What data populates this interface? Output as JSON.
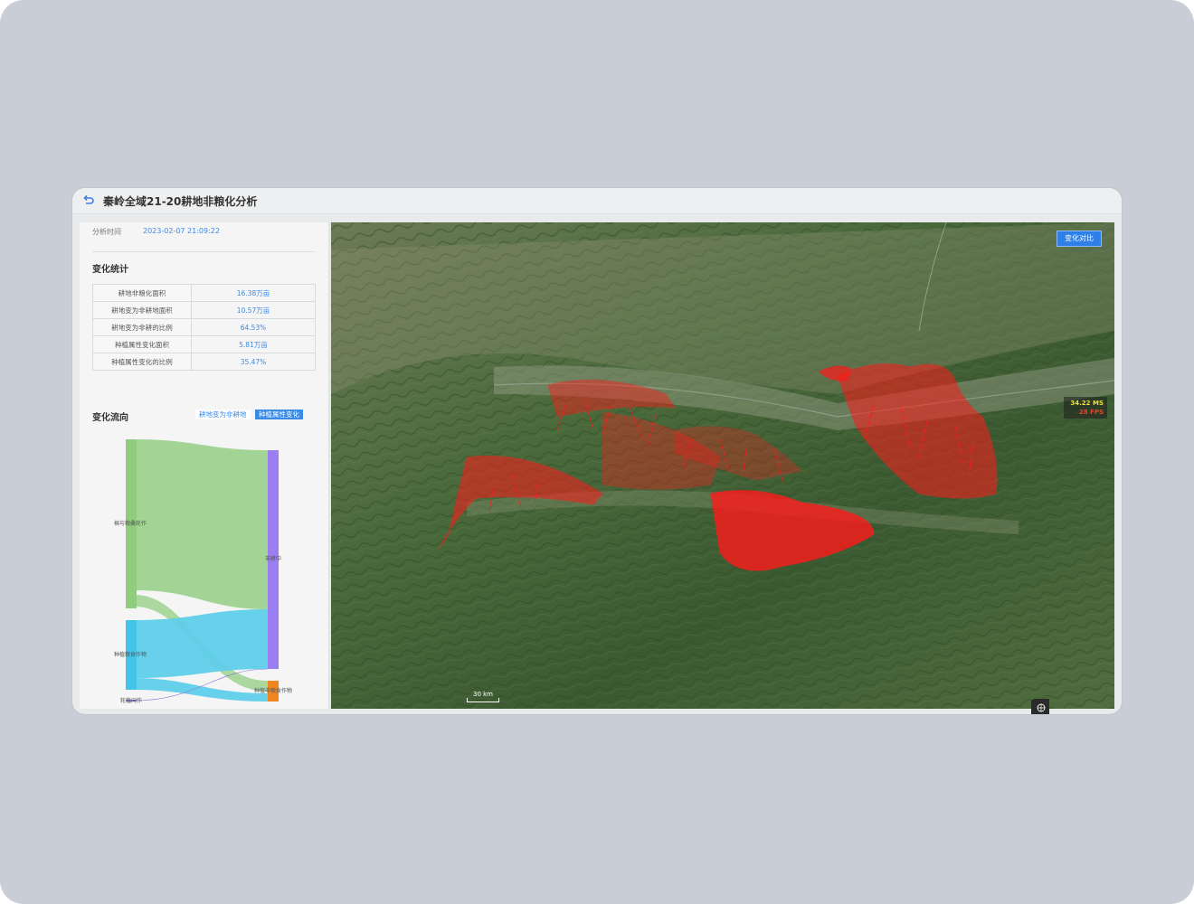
{
  "window": {
    "title": "秦岭全域21-20耕地非粮化分析"
  },
  "panel": {
    "analysis_time_label": "分析时间",
    "analysis_time_value": "2023-02-07 21:09:22",
    "stats_title": "变化统计",
    "stats": [
      {
        "label": "耕地非粮化面积",
        "value": "16.38万亩"
      },
      {
        "label": "耕地变为非耕地面积",
        "value": "10.57万亩"
      },
      {
        "label": "耕地变为非耕的比例",
        "value": "64.53%"
      },
      {
        "label": "种植属性变化面积",
        "value": "5.81万亩"
      },
      {
        "label": "种植属性变化的比例",
        "value": "35.47%"
      }
    ],
    "flow_title": "变化流向",
    "tabs": [
      {
        "label": "耕地变为非耕地",
        "active": false
      },
      {
        "label": "种植属性变化",
        "active": true
      }
    ]
  },
  "sankey": {
    "nodes_left": [
      "棉与粮桑轮作",
      "种植粮食作物",
      "轮植闲作"
    ],
    "nodes_right": [
      "非耕中",
      "种植非粮食作物"
    ],
    "colors": {
      "left_1": "#8fcc7d",
      "left_2": "#43c3e6",
      "left_3": "#8b78d9",
      "right_1": "#9a7ef2",
      "right_2": "#f2861e"
    }
  },
  "map": {
    "compare_button": "变化对比",
    "perf_ms": "34.22 MS",
    "perf_fps": "28 FPS",
    "scale_label": "30 km",
    "highlight_color": "#ff1a1a"
  },
  "icons": {
    "back": "back-arrow-icon",
    "globe": "globe-icon"
  }
}
